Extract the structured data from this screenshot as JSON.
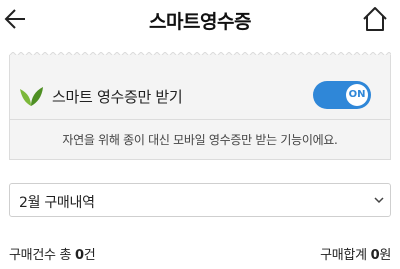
{
  "header": {
    "title": "스마트영수증",
    "back_icon": "arrow-left-icon",
    "home_icon": "home-icon"
  },
  "smart_receipt": {
    "label": "스마트 영수증만 받기",
    "icon": "leaf-icon",
    "toggle_state": "ON",
    "toggle_color": "#2f87d8",
    "description": "자연을 위해 종이 대신 모바일 영수증만 받는 기능이에요."
  },
  "filter": {
    "selected_month": "2월 구매내역"
  },
  "summary": {
    "count_label": "구매건수 총 ",
    "count_value": "0",
    "count_unit": "건",
    "total_label": "구매합계 ",
    "total_value": "0",
    "total_unit": "원"
  }
}
